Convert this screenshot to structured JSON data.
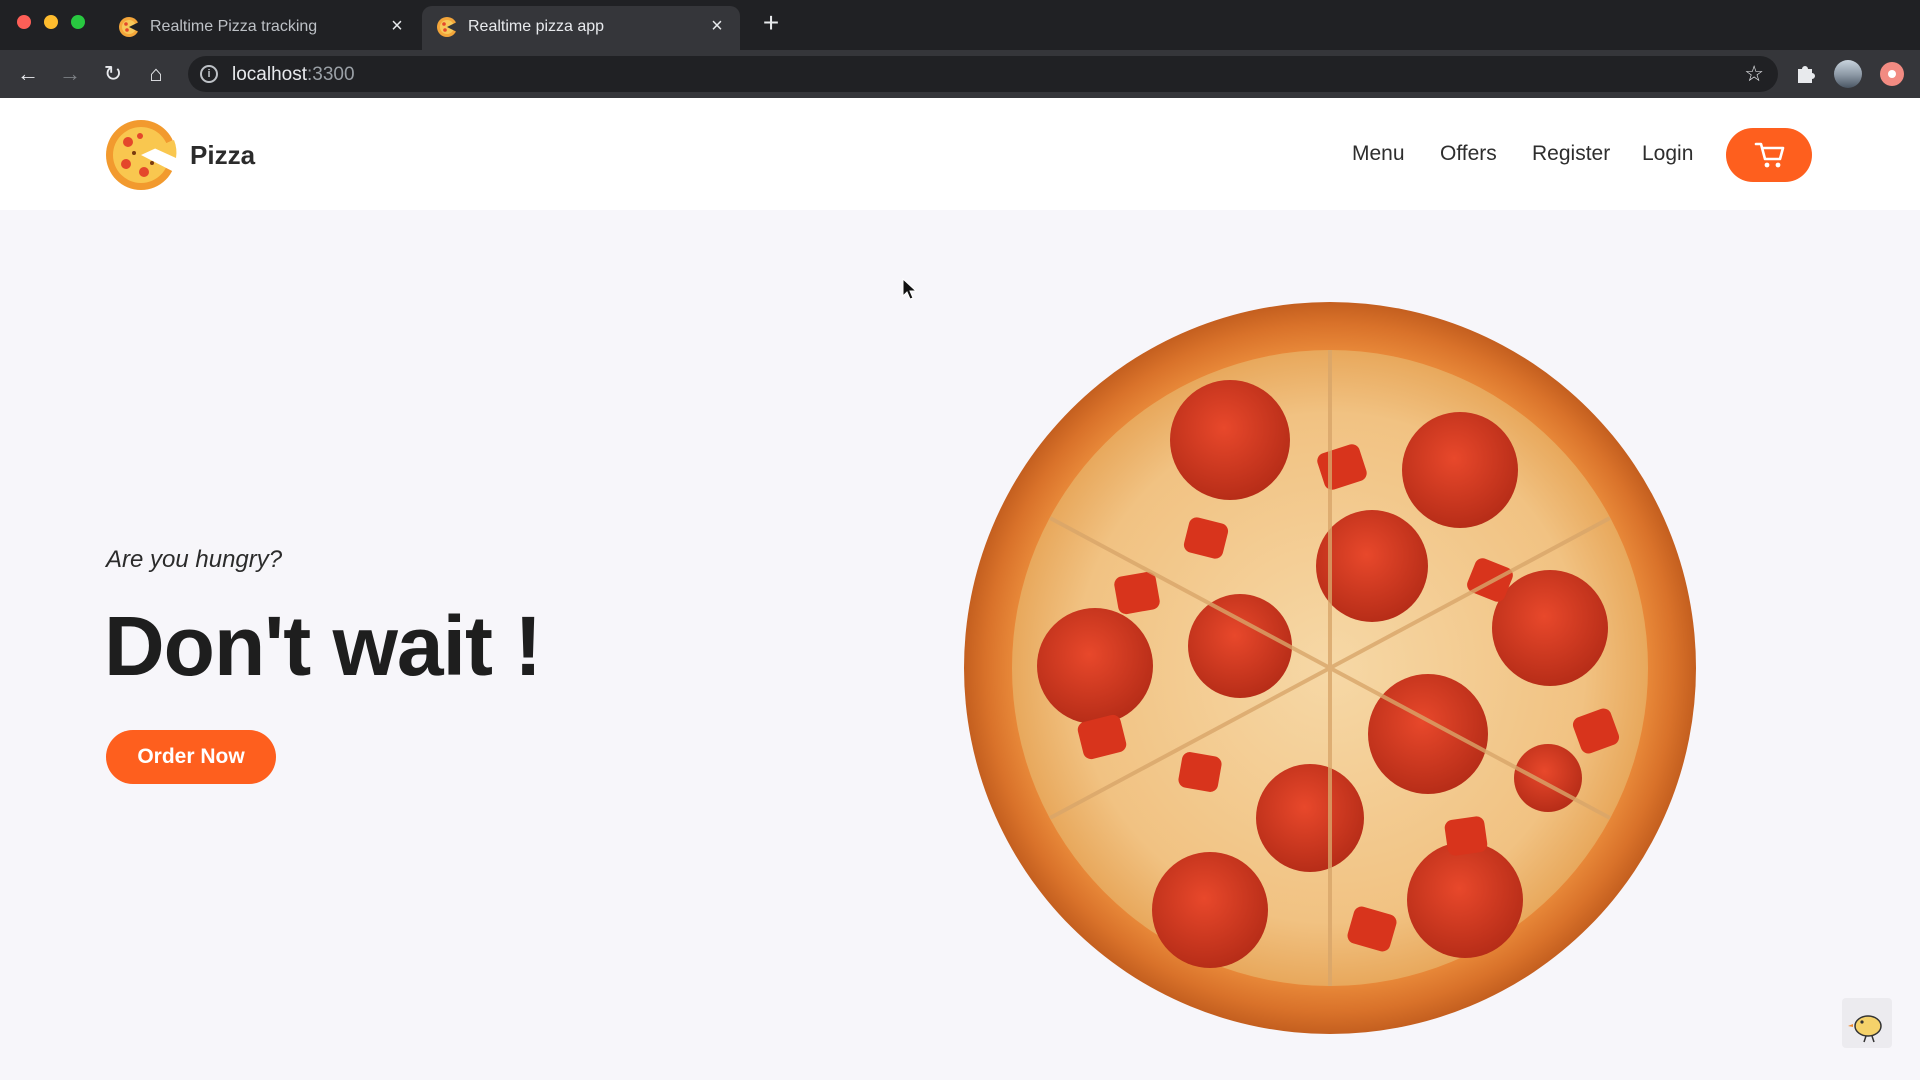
{
  "browser": {
    "tabs": [
      {
        "title": "Realtime Pizza tracking",
        "active": false
      },
      {
        "title": "Realtime pizza app",
        "active": true
      }
    ],
    "address": {
      "host": "localhost",
      "port": ":3300"
    }
  },
  "site": {
    "brand": "Pizza",
    "nav": {
      "menu": "Menu",
      "offers": "Offers",
      "register": "Register",
      "login": "Login"
    },
    "hero": {
      "subtitle": "Are you hungry?",
      "title": "Don't wait !",
      "cta": "Order Now"
    }
  },
  "colors": {
    "accent": "#fe5f1e",
    "page_bg": "#f7f6fa",
    "header_bg": "#ffffff"
  },
  "icons": [
    "pizza-logo-icon",
    "cart-icon",
    "star-icon",
    "extensions-icon",
    "info-icon"
  ]
}
